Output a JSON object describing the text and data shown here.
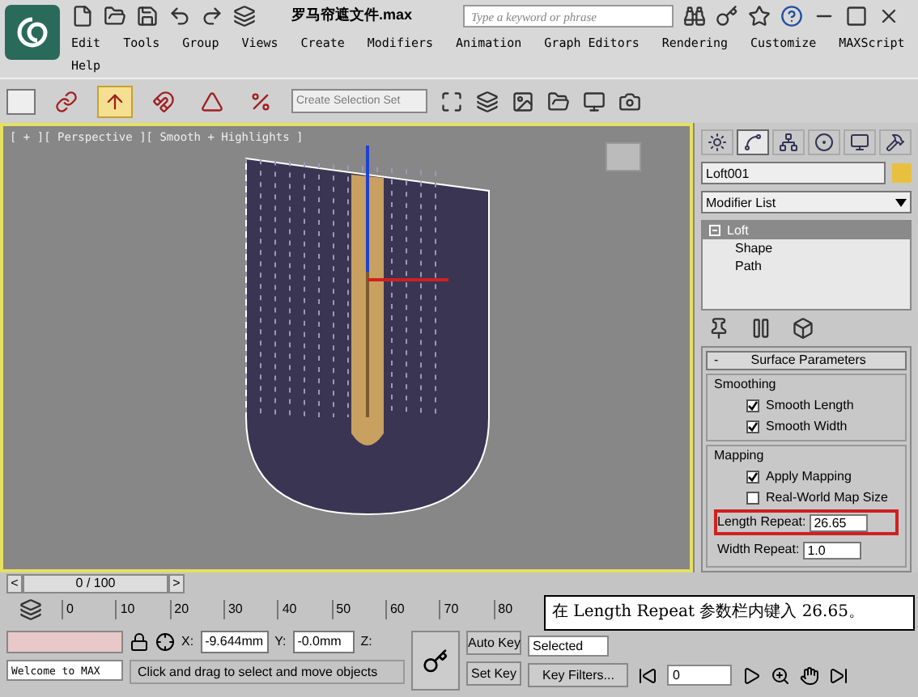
{
  "title_bar": {
    "title": "罗马帘遮文件.max",
    "search": {
      "placeholder": "Type a keyword or phrase"
    }
  },
  "menu": [
    "Edit",
    "Tools",
    "Group",
    "Views",
    "Create",
    "Modifiers",
    "Animation",
    "Graph Editors",
    "Rendering",
    "Customize",
    "MAXScript",
    "Help"
  ],
  "toolbar": {
    "tools": [
      {
        "kind": "link",
        "selected": false
      },
      {
        "kind": "move",
        "selected": true
      },
      {
        "kind": "snap",
        "selected": false
      },
      {
        "kind": "angle",
        "selected": false
      },
      {
        "kind": "percent",
        "selected": false
      }
    ],
    "selection_set": {
      "placeholder": "Create Selection Set"
    }
  },
  "viewport": {
    "label": "[ + ][ Perspective ][ Smooth + Highlights ]"
  },
  "command_panel": {
    "tabs": [
      {
        "kind": "create",
        "selected": false
      },
      {
        "kind": "modify",
        "selected": true
      },
      {
        "kind": "hierarchy",
        "selected": false
      },
      {
        "kind": "motion",
        "selected": false
      },
      {
        "kind": "display",
        "selected": false
      },
      {
        "kind": "utilities",
        "selected": false
      }
    ],
    "object_name": "Loft001",
    "modifier_list": "Modifier List",
    "stack": [
      {
        "label": "Loft",
        "selected": true,
        "children": [
          {
            "label": "Shape",
            "selected": false
          },
          {
            "label": "Path",
            "selected": false
          }
        ]
      }
    ],
    "rollout": {
      "toggle": "-",
      "title": "Surface Parameters",
      "groups": [
        {
          "title": "Smoothing",
          "options": [
            {
              "label": "Smooth Length",
              "checked": true
            },
            {
              "label": "Smooth Width",
              "checked": true
            }
          ]
        },
        {
          "title": "Mapping",
          "options": [
            {
              "label": "Apply Mapping",
              "checked": true
            },
            {
              "label": "Real-World Map Size",
              "checked": false
            }
          ],
          "fields": [
            {
              "label": "Length Repeat:",
              "value": "26.65",
              "highlighted": true
            },
            {
              "label": "Width Repeat:",
              "value": "1.0",
              "highlighted": false
            }
          ]
        }
      ]
    }
  },
  "time_slider": {
    "prev": "<",
    "position": "0 / 100",
    "next": ">"
  },
  "timeline": {
    "ticks": [
      "0",
      "10",
      "20",
      "30",
      "40",
      "50",
      "60",
      "70",
      "80"
    ]
  },
  "status": {
    "listener": "Welcome to MAX",
    "prompt": "Click and drag to select and move objects",
    "x_label": "X:",
    "x": "-9.644mm",
    "y_label": "Y:",
    "y": "-0.0mm",
    "z_label": "Z:",
    "auto_key": "Auto Key",
    "set_key": "Set Key",
    "selection": "Selected",
    "key_filters": "Key Filters...",
    "frame": "0"
  },
  "callout": "在 Length Repeat 参数栏内键入 26.65。"
}
